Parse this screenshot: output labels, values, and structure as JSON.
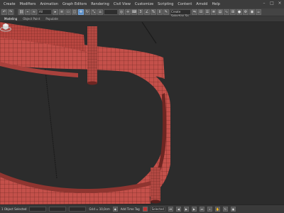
{
  "menubar": {
    "items": [
      "Create",
      "Modifiers",
      "Animation",
      "Graph Editors",
      "Rendering",
      "Civil View",
      "Customize",
      "Scripting",
      "Content",
      "Arnold",
      "Help"
    ],
    "window_controls": [
      "–",
      "□",
      "×"
    ]
  },
  "toolbar": {
    "selection_filter": "All",
    "named_selection": "Create Selection Se"
  },
  "ribbon": {
    "tabs": [
      "Modeling",
      "Object Paint",
      "Populate"
    ]
  },
  "viewport": {
    "label": "",
    "colors": {
      "mesh_outer": "#c4504a",
      "mesh_inner": "#a8413c",
      "wire": "#5a1f1c",
      "background": "#2c2c2c",
      "cable": "#1a1a1a"
    }
  },
  "statusbar": {
    "selection_text": "1 Object Selected",
    "grid_label": "Grid = 10,0cm",
    "add_time_tag": "Add Time Tag",
    "auto_key": "Auto Key",
    "selected": "Selected"
  }
}
